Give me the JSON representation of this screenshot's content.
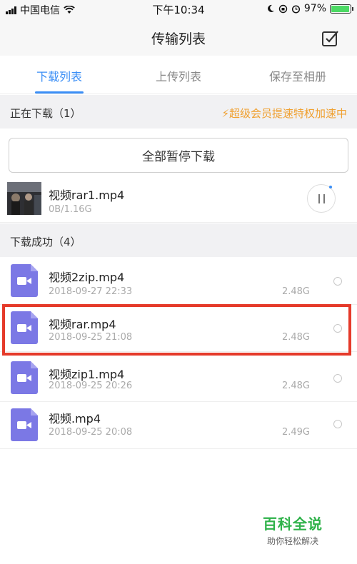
{
  "status_bar": {
    "carrier": "中国电信",
    "time": "下午10:34",
    "battery_percent": "97%",
    "battery_level": 0.97
  },
  "nav": {
    "title": "传输列表",
    "edit_icon": "checkbox-edit-icon"
  },
  "tabs": [
    {
      "label": "下载列表",
      "active": true
    },
    {
      "label": "上传列表",
      "active": false
    },
    {
      "label": "保存至相册",
      "active": false
    }
  ],
  "downloading": {
    "header": "正在下载（1）",
    "promo": "⚡超级会员提速特权加速中",
    "pause_all_label": "全部暂停下载",
    "item": {
      "name": "视频rar1.mp4",
      "progress_text": "0B/1.16G"
    }
  },
  "completed": {
    "header": "下载成功（4）",
    "items": [
      {
        "name": "视频2zip.mp4",
        "date": "2018-09-27 22:33",
        "size": "2.48G"
      },
      {
        "name": "视频rar.mp4",
        "date": "2018-09-25 21:08",
        "size": "2.48G"
      },
      {
        "name": "视频zip1.mp4",
        "date": "2018-09-25 20:26",
        "size": "2.48G"
      },
      {
        "name": "视频.mp4",
        "date": "2018-09-25 20:08",
        "size": "2.49G"
      }
    ]
  },
  "watermark": {
    "main": "百科全说",
    "sub": "助你轻松解决"
  },
  "colors": {
    "accent": "#3a8ef6",
    "promo": "#f0a030",
    "file_icon": "#7b78e5",
    "highlight": "#e53a2a",
    "watermark": "#2fb24a"
  }
}
